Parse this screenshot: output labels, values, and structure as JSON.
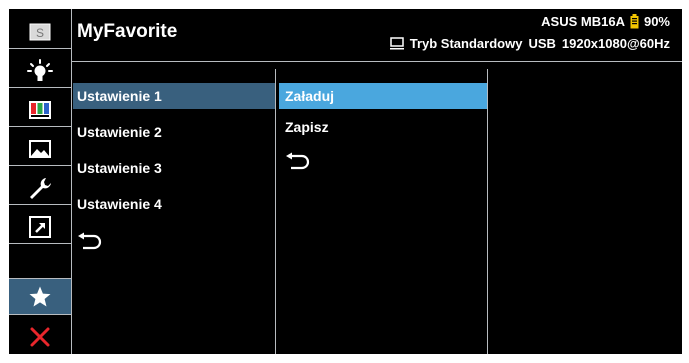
{
  "header": {
    "title": "MyFavorite",
    "model": "ASUS MB16A",
    "battery": "90%",
    "mode": "Tryb Standardowy",
    "source": "USB",
    "resolution": "1920x1080@60Hz"
  },
  "sidebar": {
    "items": [
      {
        "icon": "splendid-icon"
      },
      {
        "icon": "blue-light-filter-icon"
      },
      {
        "icon": "color-icon"
      },
      {
        "icon": "image-icon"
      },
      {
        "icon": "system-setup-icon"
      },
      {
        "icon": "shortcut-icon"
      },
      {
        "icon": "myfavorite-star-icon"
      },
      {
        "icon": "exit-icon"
      }
    ],
    "active_color": "#39607e",
    "exit_color": "#e8262c"
  },
  "menu1": {
    "items": [
      "Ustawienie 1",
      "Ustawienie 2",
      "Ustawienie 3",
      "Ustawienie 4"
    ],
    "selected": "Ustawienie 1"
  },
  "menu2": {
    "items": [
      "Załaduj",
      "Zapisz"
    ],
    "selected": "Załaduj"
  },
  "colors": {
    "background": "#000000",
    "highlight_primary": "#39607e",
    "highlight_secondary": "#4aa7de",
    "battery": "#f2c500"
  }
}
